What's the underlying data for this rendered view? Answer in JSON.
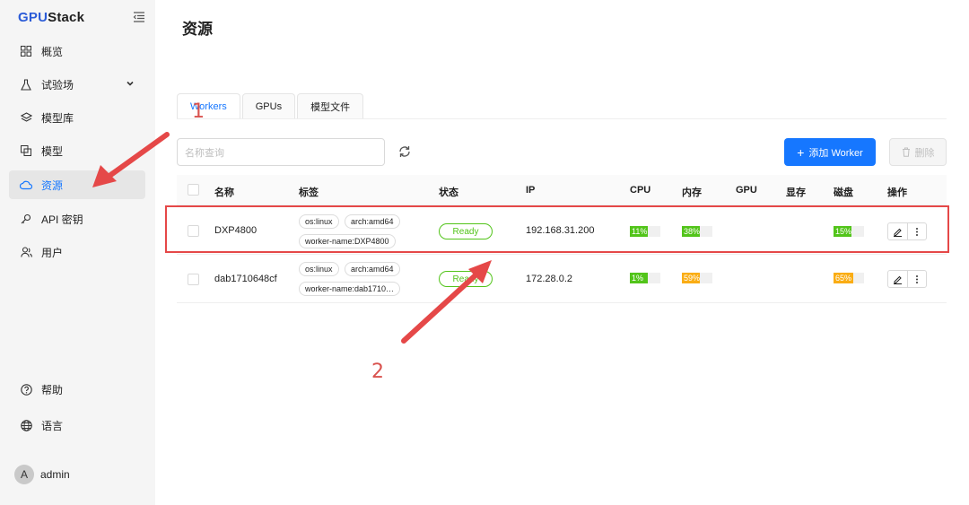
{
  "app": {
    "logo_part1": "GPU",
    "logo_part2": "Stack"
  },
  "sidebar": {
    "items": [
      {
        "label": "概览",
        "icon": "dashboard-icon"
      },
      {
        "label": "试验场",
        "icon": "flask-icon"
      },
      {
        "label": "模型库",
        "icon": "layers-icon"
      },
      {
        "label": "模型",
        "icon": "model-icon"
      },
      {
        "label": "资源",
        "icon": "cloud-icon"
      },
      {
        "label": "API 密钥",
        "icon": "key-icon"
      },
      {
        "label": "用户",
        "icon": "users-icon"
      }
    ],
    "help": "帮助",
    "language": "语言",
    "user": {
      "avatar_letter": "A",
      "name": "admin"
    }
  },
  "page": {
    "title": "资源"
  },
  "tabs": [
    {
      "label": "Workers"
    },
    {
      "label": "GPUs"
    },
    {
      "label": "模型文件"
    }
  ],
  "toolbar": {
    "search_placeholder": "名称查询",
    "add_label": "添加 Worker",
    "delete_label": "删除"
  },
  "table": {
    "headers": {
      "name": "名称",
      "labels": "标签",
      "status": "状态",
      "ip": "IP",
      "cpu": "CPU",
      "memory": "内存",
      "gpu": "GPU",
      "vram": "显存",
      "disk": "磁盘",
      "actions": "操作"
    },
    "rows": [
      {
        "name": "DXP4800",
        "tags": [
          "os:linux",
          "arch:amd64",
          "worker-name:DXP4800"
        ],
        "status": "Ready",
        "ip": "192.168.31.200",
        "cpu": {
          "text": "11%",
          "value": 0.11
        },
        "memory": {
          "text": "38%",
          "value": 0.38
        },
        "disk": {
          "text": "15%",
          "value": 0.15
        }
      },
      {
        "name": "dab1710648cf",
        "tags": [
          "os:linux",
          "arch:amd64",
          "worker-name:dab1710…"
        ],
        "status": "Ready",
        "ip": "172.28.0.2",
        "cpu": {
          "text": "1%",
          "value": 0.01
        },
        "memory": {
          "text": "59%",
          "value": 0.59
        },
        "disk": {
          "text": "65%",
          "value": 0.65
        }
      }
    ]
  },
  "colors": {
    "accent": "#1677ff",
    "ready": "#52c41a",
    "usage_low": "#52c41a",
    "usage_mid": "#faad14",
    "annotation": "#e54848"
  },
  "annotations": {
    "one": "1",
    "two": "2"
  }
}
